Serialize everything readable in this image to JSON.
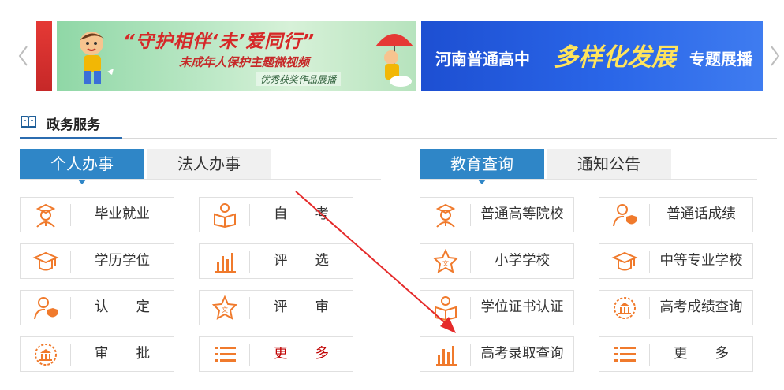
{
  "banner": {
    "slide_a": {
      "quote": "“守护相伴‘未’爱同行”",
      "subtitle": "未成年人保护主题微视频",
      "tag": "优秀获奖作品展播"
    },
    "slide_b": {
      "part1": "河南普通高中",
      "part2": "多样化发展",
      "part3": "专题展播"
    }
  },
  "section": {
    "title": "政务服务"
  },
  "left_panel": {
    "tabs": [
      {
        "label": "个人办事",
        "active": true
      },
      {
        "label": "法人办事",
        "active": false
      }
    ],
    "items": [
      {
        "label": "毕业就业",
        "icon": "graduate-icon"
      },
      {
        "label": "自　　考",
        "icon": "reading-person-icon"
      },
      {
        "label": "学历学位",
        "icon": "mortarboard-icon"
      },
      {
        "label": "评　　选",
        "icon": "bar-chart-icon"
      },
      {
        "label": "认　　定",
        "icon": "user-shield-icon"
      },
      {
        "label": "评　　审",
        "icon": "star-badge-icon"
      },
      {
        "label": "审　　批",
        "icon": "seal-icon"
      },
      {
        "label": "更　　多",
        "icon": "list-icon",
        "red": true
      }
    ]
  },
  "right_panel": {
    "tabs": [
      {
        "label": "教育查询",
        "active": true
      },
      {
        "label": "通知公告",
        "active": false
      }
    ],
    "items": [
      {
        "label": "普通高等院校",
        "icon": "graduate-icon"
      },
      {
        "label": "普通话成绩",
        "icon": "user-shield-icon"
      },
      {
        "label": "小学学校",
        "icon": "star-badge-icon"
      },
      {
        "label": "中等专业学校",
        "icon": "mortarboard-icon"
      },
      {
        "label": "学位证书认证",
        "icon": "reading-person-icon"
      },
      {
        "label": "高考成绩查询",
        "icon": "seal-icon"
      },
      {
        "label": "高考录取查询",
        "icon": "bar-chart-icon"
      },
      {
        "label": "更　　多",
        "icon": "list-icon"
      }
    ]
  },
  "colors": {
    "accent": "#2f86c7",
    "icon": "#f07a2c",
    "annotation": "#e52a2a"
  }
}
